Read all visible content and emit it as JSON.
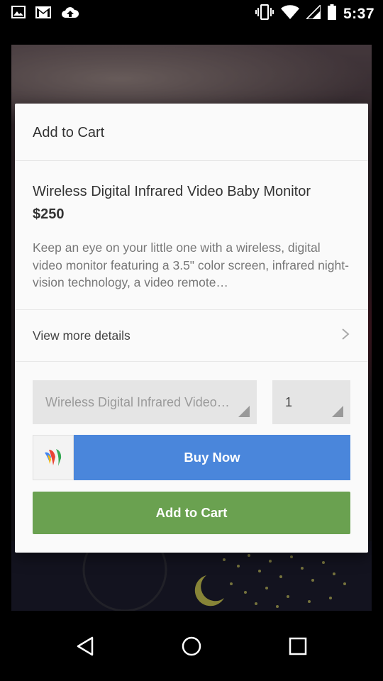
{
  "status_bar": {
    "time": "5:37",
    "left_icons": [
      "image-icon",
      "gmail-icon",
      "cloud-upload-icon"
    ],
    "right_icons": [
      "vibrate-icon",
      "wifi-icon",
      "signal-icon",
      "battery-icon"
    ]
  },
  "dialog": {
    "title": "Add to Cart",
    "product": {
      "name": "Wireless Digital Infrared Video Baby Monitor",
      "price": "$250",
      "description": "Keep an eye on your little one with a wireless, digital video monitor featuring a 3.5\" color screen, infrared night-vision technology, a video remote…"
    },
    "details_link": "View more details",
    "variant_select": {
      "value": "Wireless Digital Infrared Video…"
    },
    "quantity_select": {
      "value": "1"
    },
    "buy_now_label": "Buy Now",
    "add_to_cart_label": "Add to Cart"
  },
  "colors": {
    "buy_now": "#4a86db",
    "add_to_cart": "#6aa150",
    "dialog_bg": "#fafafa"
  },
  "nav_bar": {
    "icons": [
      "back-icon",
      "home-icon",
      "recents-icon"
    ]
  }
}
